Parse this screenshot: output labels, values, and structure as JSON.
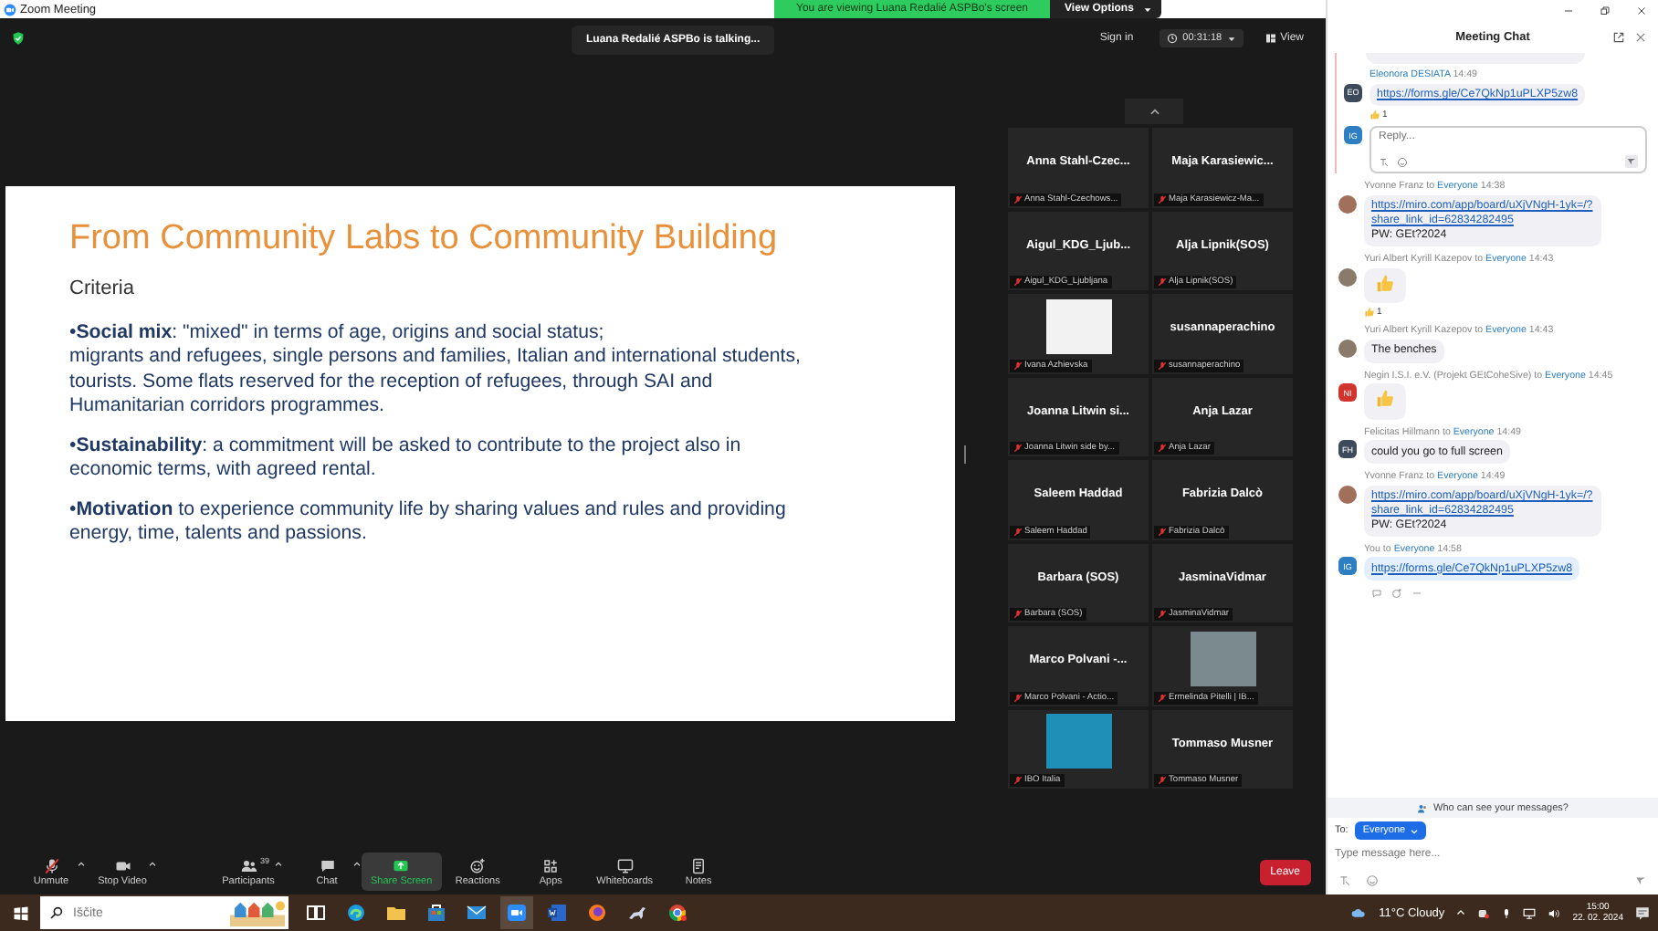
{
  "window": {
    "title": "Zoom Meeting"
  },
  "banner": {
    "text": "You are viewing Luana Redalié ASPBo's screen",
    "button": "View Options"
  },
  "top_bar": {
    "toast": "Luana Redalié ASPBo is talking...",
    "sign_in": "Sign in",
    "timer": "00:31:18",
    "view": "View"
  },
  "slide": {
    "title": "From Community Labs to Community Building",
    "subtitle": "Criteria",
    "bullets": [
      "•**Social mix**: \"mixed\" in terms of age, origins and social status;\nmigrants and refugees, single persons and families, Italian and international students, tourists. Some flats reserved for the reception of refugees, through SAI and Humanitarian corridors programmes.",
      "•**Sustainability**: a commitment will be asked to contribute to the project also in economic terms, with agreed rental.",
      "•**Motivation** to experience community life by sharing values and rules and providing energy, time, talents and passions."
    ]
  },
  "gallery": [
    {
      "tiles": [
        {
          "label": "Anna Stahl-Czechows...",
          "kind": "name",
          "display_name": "Anna  Stahl-Czec...",
          "muted": true
        },
        {
          "label": "Maja Karasiewicz-Ma...",
          "kind": "name",
          "display_name": "Maja  Karasiewic...",
          "muted": true
        }
      ]
    },
    {
      "tiles": [
        {
          "label": "Aigul_KDG_Ljubljana",
          "kind": "name",
          "display_name": "Aigul_KDG_Ljub...",
          "muted": true
        },
        {
          "label": "Alja Lipnik(SOS)",
          "kind": "name",
          "display_name": "Alja Lipnik(SOS)",
          "muted": true
        }
      ]
    },
    {
      "tiles": [
        {
          "label": "Ivana Azhievska",
          "kind": "logo",
          "muted": true
        },
        {
          "label": "susannaperachino",
          "kind": "name",
          "display_name": "susannaperachino",
          "muted": true
        }
      ]
    },
    {
      "tiles": [
        {
          "label": "Joanna Litwin side by...",
          "kind": "name",
          "display_name": "Joanna Litwin si...",
          "muted": true
        },
        {
          "label": "Anja Lazar",
          "kind": "name",
          "display_name": "Anja Lazar",
          "muted": true
        }
      ]
    },
    {
      "tiles": [
        {
          "label": "Saleem Haddad",
          "kind": "name",
          "display_name": "Saleem Haddad",
          "muted": true
        },
        {
          "label": "Fabrizia Dalcò",
          "kind": "name",
          "display_name": "Fabrizia Dalcò",
          "muted": true
        }
      ]
    },
    {
      "tiles": [
        {
          "label": "Barbara (SOS)",
          "kind": "name",
          "display_name": "Barbara (SOS)",
          "muted": true
        },
        {
          "label": "JasminaVidmar",
          "kind": "name",
          "display_name": "JasminaVidmar",
          "muted": true
        }
      ]
    },
    {
      "tiles": [
        {
          "label": "Marco Polvani - Actio...",
          "kind": "name",
          "display_name": "Marco  Polvani -...",
          "muted": true
        },
        {
          "label": "Ermelinda Pitelli | IB...",
          "kind": "photo",
          "muted": true
        }
      ]
    },
    {
      "tiles": [
        {
          "label": "IBO Italia",
          "kind": "logo",
          "muted": true
        },
        {
          "label": "Tommaso Musner",
          "kind": "name",
          "display_name": "Tommaso Musner",
          "muted": true
        }
      ]
    }
  ],
  "toolbar": [
    {
      "kind": "mic",
      "label": "Unmute",
      "caret": true,
      "active": false
    },
    {
      "kind": "video",
      "label": "Stop Video",
      "caret": true,
      "active": false
    },
    {
      "kind": "participants",
      "label": "Participants",
      "count": "39",
      "caret": true,
      "active": false
    },
    {
      "kind": "chat",
      "label": "Chat",
      "caret": true,
      "active": false
    },
    {
      "kind": "share",
      "label": "Share Screen",
      "caret": false,
      "active": true
    },
    {
      "kind": "reactions",
      "label": "Reactions",
      "caret": false,
      "active": false
    },
    {
      "kind": "apps",
      "label": "Apps",
      "caret": false,
      "active": false
    },
    {
      "kind": "whiteboards",
      "label": "Whiteboards",
      "caret": false,
      "active": false
    },
    {
      "kind": "notes",
      "label": "Notes",
      "caret": false,
      "active": false
    }
  ],
  "leave_button": "Leave",
  "chat": {
    "title": "Meeting Chat",
    "thread": {
      "sender": "Eleonora DESIATA",
      "time": "14:49",
      "avatar": {
        "kind": "initials",
        "initials": "EO",
        "color": "#3d4a5c"
      },
      "lines": [
        {
          "kind": "link",
          "text": "https://forms.gle/Ce7QkNp1uPLXP5zw8"
        }
      ],
      "reaction": "1",
      "reply_avatar": {
        "kind": "initials",
        "initials": "IG",
        "color": "#2d7fc1"
      },
      "reply_placeholder": "Reply..."
    },
    "messages": [
      {
        "sender": "Yvonne Franz",
        "to": "to",
        "recipient": "Everyone",
        "time": "14:38",
        "own": false,
        "avatar": {
          "kind": "photo",
          "color": "#a0705a"
        },
        "lines": [
          {
            "kind": "link",
            "text": "https://miro.com/app/board/uXjVNgH-1yk=/?share_link_id=62834282495"
          },
          {
            "kind": "text",
            "text": "PW: GEt?2024"
          }
        ]
      },
      {
        "sender": "Yuri Albert Kyrill Kazepov",
        "to": "to",
        "recipient": "Everyone",
        "time": "14:43",
        "own": false,
        "avatar": {
          "kind": "photo",
          "color": "#8a7a6a"
        },
        "lines": [
          {
            "kind": "emoji"
          }
        ],
        "reaction": "1"
      },
      {
        "sender": "Yuri Albert Kyrill Kazepov",
        "to": "to",
        "recipient": "Everyone",
        "time": "14:43",
        "own": false,
        "avatar": {
          "kind": "photo",
          "color": "#8a7a6a"
        },
        "lines": [
          {
            "kind": "text",
            "text": "The benches"
          }
        ]
      },
      {
        "sender": "Negin I.S.I. e.V. (Projekt GEtCoheSive)",
        "to": "to",
        "recipient": "Everyone",
        "time": "14:45",
        "own": false,
        "avatar": {
          "kind": "initials",
          "initials": "NI",
          "color": "#d0342c"
        },
        "lines": [
          {
            "kind": "emoji"
          }
        ]
      },
      {
        "sender": "Felicitas Hillmann",
        "to": "to",
        "recipient": "Everyone",
        "time": "14:49",
        "own": false,
        "avatar": {
          "kind": "initials",
          "initials": "FH",
          "color": "#3d4a5c"
        },
        "lines": [
          {
            "kind": "text",
            "text": "could you go to full screen"
          }
        ]
      },
      {
        "sender": "Yvonne Franz",
        "to": "to",
        "recipient": "Everyone",
        "time": "14:49",
        "own": false,
        "avatar": {
          "kind": "photo",
          "color": "#a0705a"
        },
        "lines": [
          {
            "kind": "link",
            "text": "https://miro.com/app/board/uXjVNgH-1yk=/?share_link_id=62834282495"
          },
          {
            "kind": "text",
            "text": "PW: GEt?2024"
          }
        ]
      },
      {
        "sender": "You",
        "to": "to",
        "recipient": "Everyone",
        "time": "14:58",
        "own": true,
        "avatar": {
          "kind": "initials",
          "initials": "IG",
          "color": "#2d7fc1"
        },
        "lines": [
          {
            "kind": "link",
            "text": "https://forms.gle/Ce7QkNp1uPLXP5zw8"
          }
        ]
      }
    ],
    "privacy_note": "Who can see your messages?",
    "to_label": "To:",
    "to_button": "Everyone",
    "input_placeholder": "Type message here..."
  },
  "taskbar": {
    "search_placeholder": "Iščite",
    "weather": "11°C  Cloudy",
    "time": "15:00",
    "date": "22. 02. 2024"
  }
}
